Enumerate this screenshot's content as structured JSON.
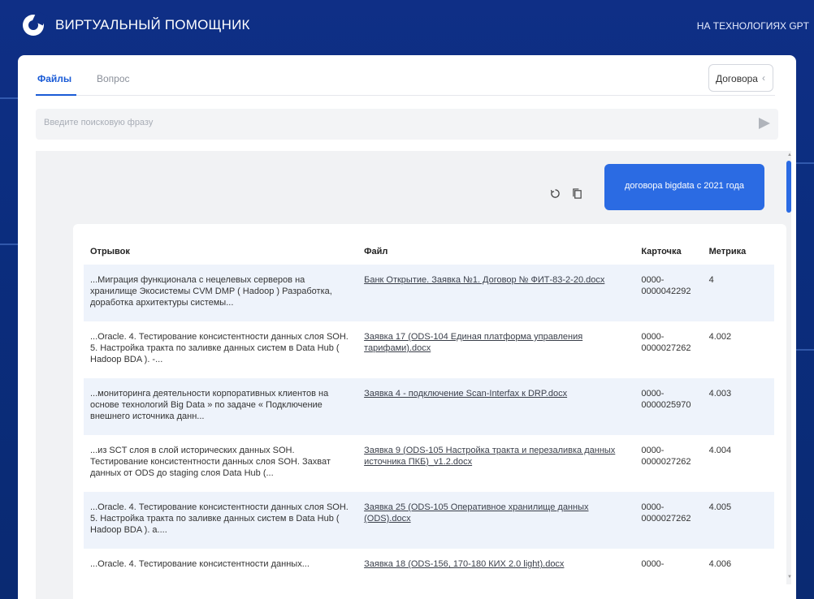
{
  "header": {
    "app_title": "ВИРТУАЛЬНЫЙ ПОМОЩНИК",
    "subtitle": "НА ТЕХНОЛОГИЯХ GPT"
  },
  "tabs": [
    {
      "label": "Файлы",
      "active": true
    },
    {
      "label": "Вопрос",
      "active": false
    }
  ],
  "dropdown": {
    "selected": "Договора",
    "icon": "chevron-left-icon"
  },
  "search": {
    "placeholder": "Введите поисковую фразу",
    "value": ""
  },
  "chat": {
    "user_message": "договора bigdata с 2021 года",
    "table": {
      "headers": [
        "Отрывок",
        "Файл",
        "Карточка",
        "Метрика"
      ],
      "rows": [
        {
          "excerpt": "...Миграция функционала с нецелевых серверов на хранилище Экосистемы CVM DMP ( Hadoop ) Разработка, доработка архитектуры системы...",
          "file": "Банк Открытие. Заявка №1. Договор № ФИТ-83-2-20.docx",
          "card": "0000-0000042292",
          "metric": "4"
        },
        {
          "excerpt": "...Oracle. 4. Тестирование консистентности данных слоя SOH. 5. Настройка тракта по заливке данных систем в Data Hub ( Hadoop BDA ). -...",
          "file": "Заявка 17 (ODS-104 Единая платформа управления тарифами).docx",
          "card": "0000-0000027262",
          "metric": "4.002"
        },
        {
          "excerpt": "...мониторинга деятельности корпоративных клиентов на основе технологий Big Data » по задаче « Подключение внешнего источника данн...",
          "file": "Заявка 4 - подключение Scan-Interfax к DRP.docx",
          "card": "0000-0000025970",
          "metric": "4.003"
        },
        {
          "excerpt": "...из SCT слоя в слой исторических данных SOH. Тестирование консистентности данных слоя SOH. Захват данных от ODS до staging слоя Data Hub (...",
          "file": "Заявка 9 (ODS-105 Настройка тракта и перезаливка данных источника ПКБ)_v1.2.docx",
          "card": "0000-0000027262",
          "metric": "4.004"
        },
        {
          "excerpt": "...Oracle. 4. Тестирование консистентности данных слоя SOH. 5. Настройка тракта по заливке данных систем в Data Hub ( Hadoop BDA ). а....",
          "file": "Заявка 25 (ODS-105 Оперативное хранилище данных (ODS).docx",
          "card": "0000-0000027262",
          "metric": "4.005"
        },
        {
          "excerpt": "...Oracle. 4. Тестирование консистентности данных...",
          "file": "Заявка 18 (ODS-156, 170-180 КИХ 2.0 light).docx",
          "card": "0000-",
          "metric": "4.006"
        }
      ]
    }
  },
  "colors": {
    "accent": "#2b6be3",
    "header_bg": "#0f2f86",
    "row_alt": "#eef3fb"
  }
}
